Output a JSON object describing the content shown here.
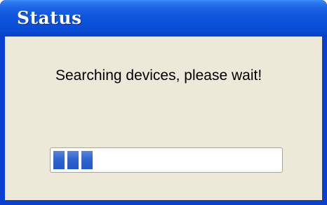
{
  "window": {
    "title": "Status"
  },
  "dialog": {
    "message": "Searching devices, please wait!"
  },
  "progress": {
    "filled_segments": 3,
    "fraction": 0.2
  },
  "colors": {
    "titlebar": "#0b4fd8",
    "client_bg": "#ece9d8",
    "progress_fill": "#3064cf"
  }
}
